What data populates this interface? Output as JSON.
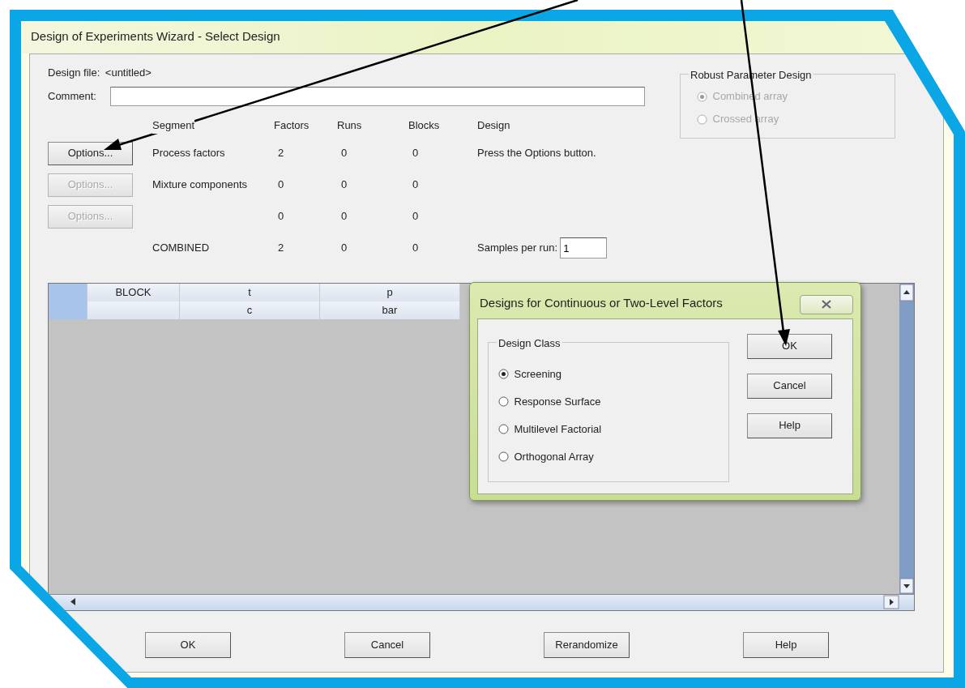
{
  "window": {
    "title": "Design of Experiments Wizard - Select Design"
  },
  "design_file": {
    "label": "Design file:",
    "value": "<untitled>"
  },
  "comment": {
    "label": "Comment:"
  },
  "segments": {
    "columns": [
      "Segment",
      "Factors",
      "Runs",
      "Blocks",
      "Design"
    ],
    "rows": [
      {
        "button": "Options...",
        "disabled": false,
        "cells": [
          "Process factors",
          "2",
          "0",
          "0",
          "Press the Options button."
        ]
      },
      {
        "button": "Options...",
        "disabled": true,
        "cells": [
          "Mixture components",
          "0",
          "0",
          "0"
        ]
      },
      {
        "button": "Options...",
        "disabled": true,
        "cells": [
          "",
          "0",
          "0",
          "0"
        ]
      }
    ],
    "combined": [
      "COMBINED",
      "2",
      "0",
      "0"
    ]
  },
  "samples_per_run": {
    "label": "Samples per run:",
    "value": "1"
  },
  "robust": {
    "title": "Robust Parameter Design",
    "disabled": true,
    "options": [
      {
        "label": "Combined array",
        "selected": true
      },
      {
        "label": "Crossed array",
        "selected": false
      }
    ]
  },
  "grid": {
    "columns": [
      {
        "label": "BLOCK"
      },
      {
        "label": "t",
        "unit": "c"
      },
      {
        "label": "p",
        "unit": "bar"
      }
    ]
  },
  "dialog": {
    "title": "Designs for Continuous or Two-Level Factors",
    "group": "Design Class",
    "options": [
      {
        "label": "Screening",
        "selected": true
      },
      {
        "label": "Response Surface",
        "selected": false
      },
      {
        "label": "Multilevel Factorial",
        "selected": false
      },
      {
        "label": "Orthogonal Array",
        "selected": false
      }
    ],
    "buttons": [
      "OK",
      "Cancel",
      "Help"
    ]
  },
  "buttons": [
    "OK",
    "Cancel",
    "Rerandomize",
    "Help"
  ]
}
